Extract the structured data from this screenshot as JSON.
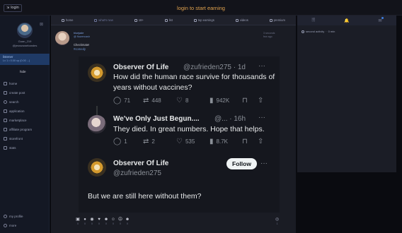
{
  "topbar": {
    "login_label": "login",
    "center_text": "login to start earning"
  },
  "sidebar": {
    "close_glyph": "⊠",
    "name": "Guan_219",
    "handle": "@jesnuwwebandes",
    "role_title": "listener",
    "role_sub": "Lv 1 • 0.00 xp (0.00 ...)",
    "hide_label": "hide",
    "nav_items": [
      {
        "label": "home",
        "icon": "home-icon"
      },
      {
        "label": "create post",
        "icon": "plus-icon"
      },
      {
        "label": "search",
        "icon": "search-icon"
      },
      {
        "label": "application",
        "icon": "app-icon"
      },
      {
        "label": "marketplace",
        "icon": "cart-icon"
      },
      {
        "label": "affiliate program",
        "icon": "affiliate-icon"
      },
      {
        "label": "storefront",
        "icon": "store-icon"
      },
      {
        "label": "stats",
        "icon": "stats-icon"
      }
    ],
    "bottom_items": [
      {
        "label": "my profile",
        "icon": "profile-icon"
      },
      {
        "label": "more",
        "icon": "more-icon"
      }
    ]
  },
  "tabs": [
    {
      "label": "home",
      "icon": "home-icon",
      "active": false
    },
    {
      "label": "what's new",
      "icon": "sparkle-icon",
      "active": true
    },
    {
      "label": "18+",
      "icon": "adult-icon",
      "active": false
    },
    {
      "label": "list",
      "icon": "list-icon",
      "active": false
    },
    {
      "label": "top earnings",
      "icon": "earnings-icon",
      "active": false
    },
    {
      "label": "videos",
      "icon": "video-icon",
      "active": false
    },
    {
      "label": "premium",
      "icon": "premium-icon",
      "active": false
    }
  ],
  "post": {
    "username": "bluejade",
    "handle": "@ flowercash",
    "text": "Checkmate!",
    "tag": "#comedy",
    "meta_time": "3 seconds",
    "meta_ago": "few ago"
  },
  "tweet": {
    "first": {
      "name": "Observer Of Life",
      "handle_time": "@zufrieden275 · 1d",
      "body": "How did the human race survive for thousands of years without vaccines?",
      "replies": "71",
      "retweets": "448",
      "likes": "8",
      "views": "942K"
    },
    "second": {
      "name": "We've Only Just Begun....",
      "handle_time": "@... · 16h",
      "body": "They died. In great numbers. Hope that helps.",
      "replies": "1",
      "retweets": "2",
      "likes": "535",
      "views": "8.7K"
    },
    "third": {
      "name": "Observer Of Life",
      "handle": "@zufrieden275",
      "follow_label": "Follow",
      "body": "But we are still here without them?"
    },
    "more_glyph": "···"
  },
  "reactions": [
    {
      "icon": "video-reaction-icon",
      "glyph": "▣",
      "count": "0"
    },
    {
      "icon": "comment-reaction-icon",
      "glyph": "●",
      "count": "0"
    },
    {
      "icon": "repost-reaction-icon",
      "glyph": "◉",
      "count": "0"
    },
    {
      "icon": "heart-reaction-icon",
      "glyph": "♥",
      "count": "0"
    },
    {
      "icon": "laugh-reaction-icon",
      "glyph": "☻",
      "count": "0"
    },
    {
      "icon": "wow-reaction-icon",
      "glyph": "☺",
      "count": "0"
    },
    {
      "icon": "sad-reaction-icon",
      "glyph": "☹",
      "count": "0"
    },
    {
      "icon": "angry-reaction-icon",
      "glyph": "☻",
      "count": "0"
    }
  ],
  "views": {
    "glyph": "◎",
    "count": "1"
  },
  "rightpanel": {
    "tabs": [
      "🗎",
      "🔔",
      "✉"
    ],
    "activity_label": "second activity",
    "activity_time": "0 min"
  },
  "colors": {
    "accent": "#e0a24e",
    "link": "#7fa3e3",
    "role_bg": "#1f3a66"
  }
}
